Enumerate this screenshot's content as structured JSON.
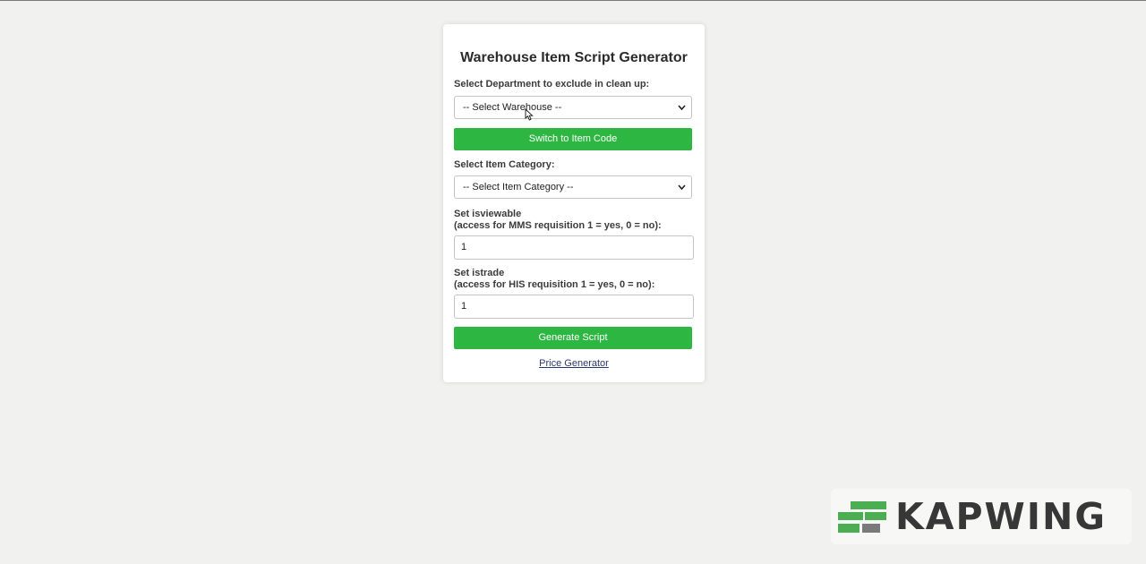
{
  "form": {
    "title": "Warehouse Item Script Generator",
    "department_label": "Select Department to exclude in clean up:",
    "warehouse_select": "-- Select Warehouse --",
    "switch_button": "Switch to Item Code",
    "category_label": "Select Item Category:",
    "category_select": "-- Select Item Category --",
    "isviewable_label_line1": "Set isviewable",
    "isviewable_label_line2": "(access for MMS requisition 1 = yes, 0 = no):",
    "isviewable_value": "1",
    "istrade_label_line1": "Set istrade",
    "istrade_label_line2": "(access for HIS requisition 1 = yes, 0 = no):",
    "istrade_value": "1",
    "generate_button": "Generate Script",
    "price_link": "Price Generator"
  },
  "watermark": {
    "brand": "KAPWING",
    "icon": "kapwing-logo-icon"
  },
  "colors": {
    "accent_green": "#2db642",
    "link": "#2a3870",
    "page_bg": "#f1f1f0",
    "card_bg": "#ffffff"
  }
}
